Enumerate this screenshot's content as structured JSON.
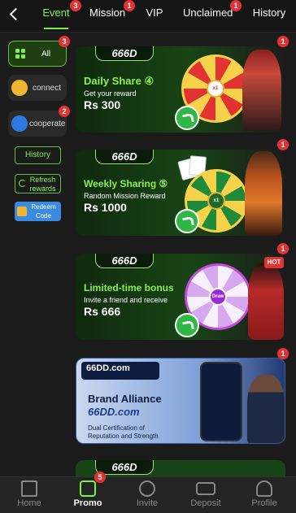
{
  "tabs": [
    {
      "label": "Event",
      "badge": "3",
      "active": true
    },
    {
      "label": "Mission",
      "badge": "1"
    },
    {
      "label": "VIP",
      "badge": ""
    },
    {
      "label": "Unclaimed",
      "badge": "1"
    },
    {
      "label": "History",
      "badge": ""
    }
  ],
  "sidebar": {
    "all": {
      "label": "All",
      "badge": "3"
    },
    "connect": {
      "label": "connect"
    },
    "cooperate": {
      "label": "cooperate",
      "badge": "2"
    },
    "history": {
      "label": "History"
    },
    "refresh": {
      "label": "Refresh rewards"
    },
    "redeem": {
      "label": "Redeem Code"
    }
  },
  "banners": [
    {
      "logo": "666D",
      "title": "Daily Share",
      "number": "④",
      "sub": "Get your reward",
      "amount": "Rs 300",
      "badge": "1",
      "wheel_center": "x1"
    },
    {
      "logo": "666D",
      "title": "Weekly Sharing",
      "number": "⑤",
      "sub": "Random Mission Reward",
      "amount": "Rs 1000",
      "badge": "1",
      "wheel_center": "x1"
    },
    {
      "logo": "666D",
      "title": "Limited-time bonus",
      "sub": "Invite a friend and receive",
      "amount": "Rs 666",
      "badge": "1",
      "hot": "HOT",
      "wheel_center": "Draw"
    }
  ],
  "alliance": {
    "logo_top": "66DD.com",
    "title": "Brand Alliance",
    "brand": "66DD.com",
    "desc1": "Dual Certification of",
    "desc2": "Reputation and Strength",
    "badge": "1"
  },
  "bottom_logo": "666D",
  "bottom_nav": [
    {
      "label": "Home"
    },
    {
      "label": "Promo",
      "badge": "5",
      "active": true
    },
    {
      "label": "Invite"
    },
    {
      "label": "Deposit"
    },
    {
      "label": "Profile"
    }
  ],
  "colors": {
    "accent": "#7df04a",
    "badge": "#e23232",
    "background": "#1b1b1b"
  }
}
